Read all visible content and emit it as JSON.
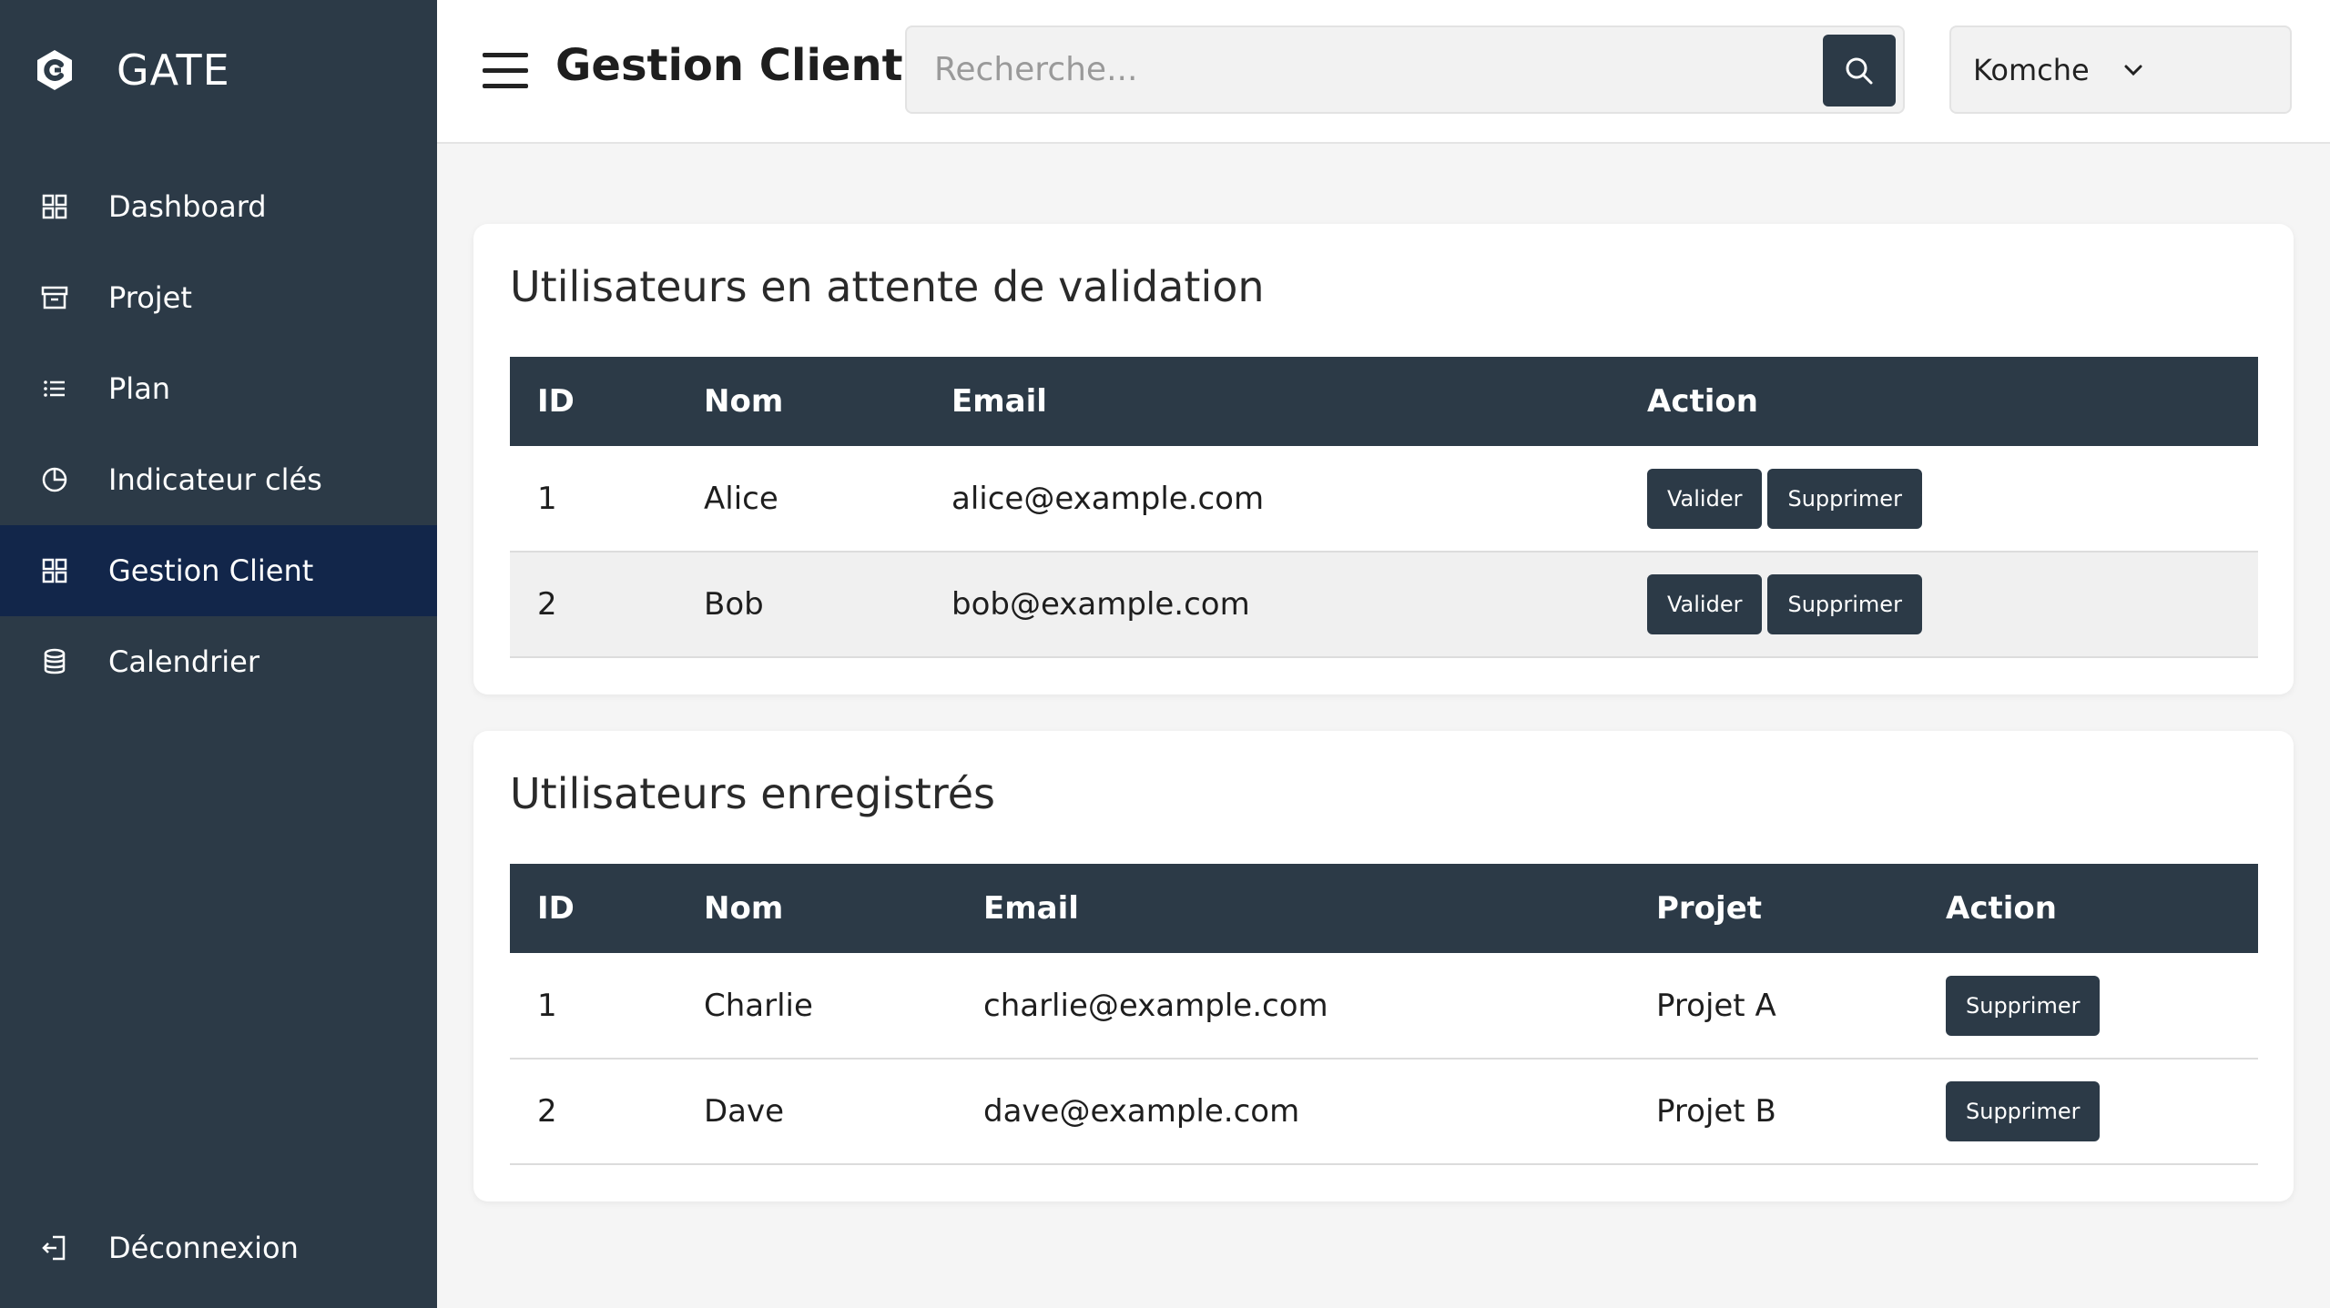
{
  "brand": {
    "name": "GATE"
  },
  "sidebar": {
    "items": [
      {
        "label": "Dashboard",
        "icon": "grid-icon"
      },
      {
        "label": "Projet",
        "icon": "archive-icon"
      },
      {
        "label": "Plan",
        "icon": "list-icon"
      },
      {
        "label": "Indicateur clés",
        "icon": "pie-chart-icon"
      },
      {
        "label": "Gestion Client",
        "icon": "grid-icon",
        "active": true
      },
      {
        "label": "Calendrier",
        "icon": "database-icon"
      }
    ],
    "logout": {
      "label": "Déconnexion",
      "icon": "logout-icon"
    }
  },
  "header": {
    "title": "Gestion Client",
    "search_placeholder": "Recherche...",
    "user": "Komche"
  },
  "pending": {
    "title": "Utilisateurs en attente de validation",
    "columns": [
      "ID",
      "Nom",
      "Email",
      "Action"
    ],
    "rows": [
      {
        "id": "1",
        "nom": "Alice",
        "email": "alice@example.com"
      },
      {
        "id": "2",
        "nom": "Bob",
        "email": "bob@example.com"
      }
    ],
    "validate_label": "Valider",
    "delete_label": "Supprimer"
  },
  "registered": {
    "title": "Utilisateurs enregistrés",
    "columns": [
      "ID",
      "Nom",
      "Email",
      "Projet",
      "Action"
    ],
    "rows": [
      {
        "id": "1",
        "nom": "Charlie",
        "email": "charlie@example.com",
        "projet": "Projet A"
      },
      {
        "id": "2",
        "nom": "Dave",
        "email": "dave@example.com",
        "projet": "Projet B"
      }
    ],
    "delete_label": "Supprimer"
  },
  "colors": {
    "sidebar": "#2c3a47",
    "active": "#12264a",
    "accent": "#2c3a47"
  }
}
